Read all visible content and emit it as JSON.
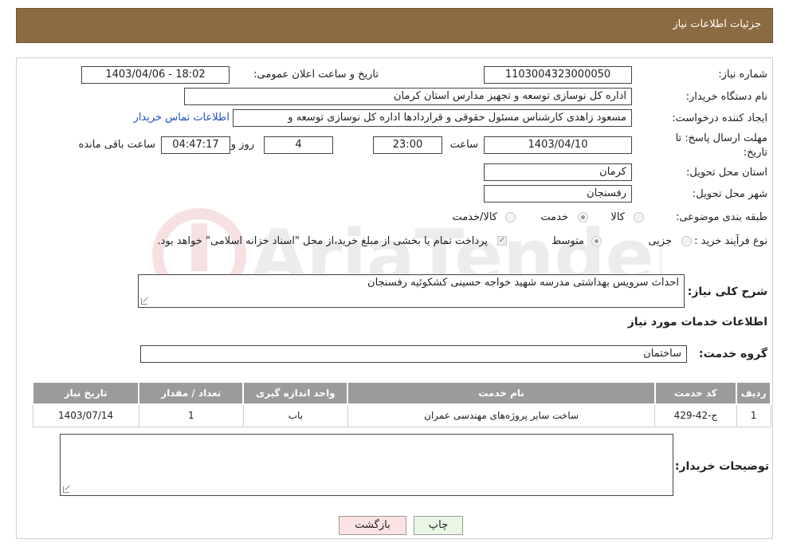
{
  "header": {
    "title": "جزئیات اطلاعات نیاز"
  },
  "form": {
    "need_number_label": "شماره نیاز:",
    "need_number_value": "1103004323000050",
    "announce_label": "تاریخ و ساعت اعلان عمومی:",
    "announce_value": "1403/04/06 - 18:02",
    "buyer_org_label": "نام دستگاه خریدار:",
    "buyer_org_value": "اداره کل نوسازی  توسعه و تجهیز مدارس استان کرمان",
    "creator_label": "ایجاد کننده درخواست:",
    "creator_value": "مسعود زاهدی کارشناس مسئول حقوقی و قراردادها اداره کل نوسازی  توسعه و",
    "contact_link": "اطلاعات تماس خریدار",
    "deadline_label_1": "مهلت ارسال پاسخ: تا",
    "deadline_label_2": "تاریخ:",
    "deadline_date": "1403/04/10",
    "time_label": "ساعت",
    "deadline_time": "23:00",
    "days_value": "4",
    "days_label": "روز و",
    "remaining_value": "04:47:17",
    "remaining_label": "ساعت باقی مانده",
    "province_label": "استان محل تحویل:",
    "province_value": "کرمان",
    "city_label": "شهر محل تحویل:",
    "city_value": "رفسنجان",
    "category_label": "طبقه بندی موضوعی:",
    "category_options": [
      "کالا",
      "خدمت",
      "کالا/خدمت"
    ],
    "category_selected": "خدمت",
    "process_label": "نوع فرآیند خرید :",
    "process_options": [
      "جزیی",
      "متوسط"
    ],
    "process_selected": "متوسط",
    "payment_note": "پرداخت تمام یا بخشی از مبلغ خرید،از محل \"اسناد خزانه اسلامی\" خواهد بود.",
    "summary_label": "شرح کلی نیاز:",
    "summary_value": "احداث سرویس بهداشتی مدرسه شهید خواجه حسینی کشکوئیه رفسنجان"
  },
  "services": {
    "section_title": "اطلاعات خدمات مورد نیاز",
    "group_label": "گروه خدمت:",
    "group_value": "ساختمان",
    "columns": [
      "ردیف",
      "کد خدمت",
      "نام خدمت",
      "واحد اندازه گیری",
      "تعداد / مقدار",
      "تاریخ نیاز"
    ],
    "rows": [
      [
        "1",
        "ج-42-429",
        "ساخت سایر پروژه‌های مهندسی عمران",
        "باب",
        "1",
        "1403/07/14"
      ]
    ]
  },
  "buyer_notes": {
    "label": "توضیحات خریدار:",
    "value": ""
  },
  "buttons": {
    "print": "چاپ",
    "back": "بازگشت"
  },
  "colors": {
    "header_bg": "#8b6c42",
    "table_header_bg": "#9b9b9b",
    "print_btn_bg": "#eaf7e4",
    "back_btn_bg": "#fbe3e3"
  },
  "watermark": {
    "text": "AriaTender.neT"
  }
}
